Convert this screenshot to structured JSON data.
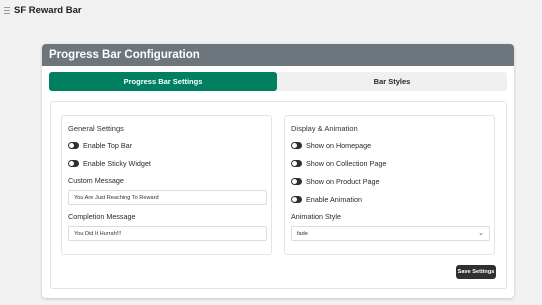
{
  "app": {
    "title": "SF Reward Bar",
    "icon": "menu-icon"
  },
  "card": {
    "title": "Progress Bar Configuration"
  },
  "tabs": [
    {
      "label": "Progress Bar Settings",
      "active": true
    },
    {
      "label": "Bar Styles",
      "active": false
    }
  ],
  "general": {
    "title": "General Settings",
    "toggles": [
      {
        "label": "Enable Top Bar",
        "on": true
      },
      {
        "label": "Enable Sticky Widget",
        "on": true
      }
    ],
    "custom_message": {
      "label": "Custom Message",
      "value": "You Are Just Reaching To Reward"
    },
    "completion_message": {
      "label": "Completion Message",
      "value": "You Did It Hurrah!!!"
    }
  },
  "display": {
    "title": "Display & Animation",
    "toggles": [
      {
        "label": "Show on Homepage",
        "on": true
      },
      {
        "label": "Show on Collection Page",
        "on": true
      },
      {
        "label": "Show on Product Page",
        "on": true
      },
      {
        "label": "Enable Animation",
        "on": true
      }
    ],
    "animation_style": {
      "label": "Animation Style",
      "value": "fade"
    }
  },
  "actions": {
    "save_label": "Save Settings"
  },
  "colors": {
    "accent": "#008060",
    "header": "#6e767d",
    "button": "#303030"
  }
}
